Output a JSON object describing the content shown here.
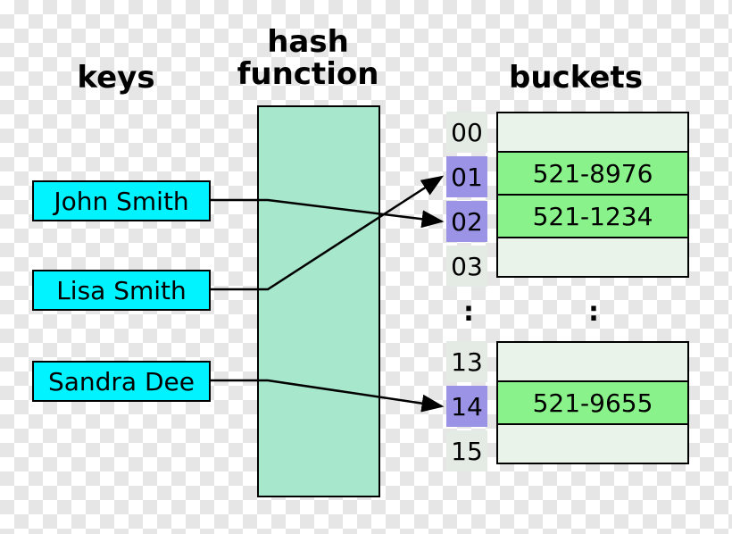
{
  "headings": {
    "keys": "keys",
    "hash_function": "hash\nfunction",
    "buckets": "buckets"
  },
  "keys": [
    {
      "name": "John Smith"
    },
    {
      "name": "Lisa Smith"
    },
    {
      "name": "Sandra Dee"
    }
  ],
  "bucket_rows_top": [
    {
      "index": "00",
      "value": "",
      "highlighted": false
    },
    {
      "index": "01",
      "value": "521-8976",
      "highlighted": true
    },
    {
      "index": "02",
      "value": "521-1234",
      "highlighted": true
    },
    {
      "index": "03",
      "value": "",
      "highlighted": false
    }
  ],
  "bucket_rows_bottom": [
    {
      "index": "13",
      "value": "",
      "highlighted": false
    },
    {
      "index": "14",
      "value": "521-9655",
      "highlighted": true
    },
    {
      "index": "15",
      "value": "",
      "highlighted": false
    }
  ],
  "ellipsis": ":",
  "mappings_description": [
    "John Smith -> bucket 02",
    "Lisa Smith -> bucket 01",
    "Sandra Dee -> bucket 14"
  ]
}
